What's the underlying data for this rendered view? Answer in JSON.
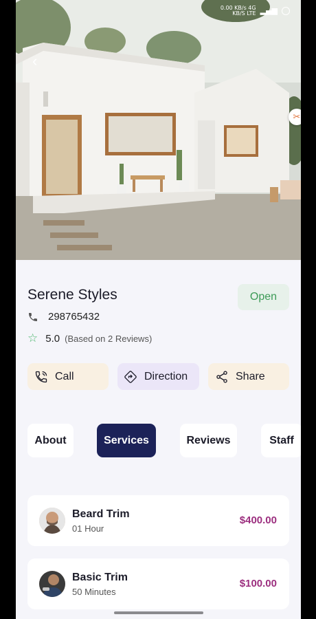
{
  "status_bar": {
    "line1": "0.00 KB/s 4G",
    "line2": "KB/S LTE",
    "bars": "▂▄▆"
  },
  "salon": {
    "name": "Serene Styles",
    "status": "Open",
    "phone": "298765432",
    "rating": "5.0",
    "reviews_text": "(Based on 2 Reviews)"
  },
  "actions": {
    "call": "Call",
    "direction": "Direction",
    "share": "Share"
  },
  "tabs": [
    {
      "label": "About"
    },
    {
      "label": "Services",
      "active": true
    },
    {
      "label": "Reviews"
    },
    {
      "label": "Staff"
    }
  ],
  "services": [
    {
      "title": "Beard Trim",
      "duration": "01 Hour",
      "price": "$400.00"
    },
    {
      "title": "Basic Trim",
      "duration": "50 Minutes",
      "price": "$100.00"
    }
  ],
  "colors": {
    "accent_navy": "#1c2258",
    "open_green": "#3c9a56",
    "price_purple": "#9c2f7f",
    "call_bg": "#f9f0e2",
    "direction_bg": "#ebe6f8"
  }
}
